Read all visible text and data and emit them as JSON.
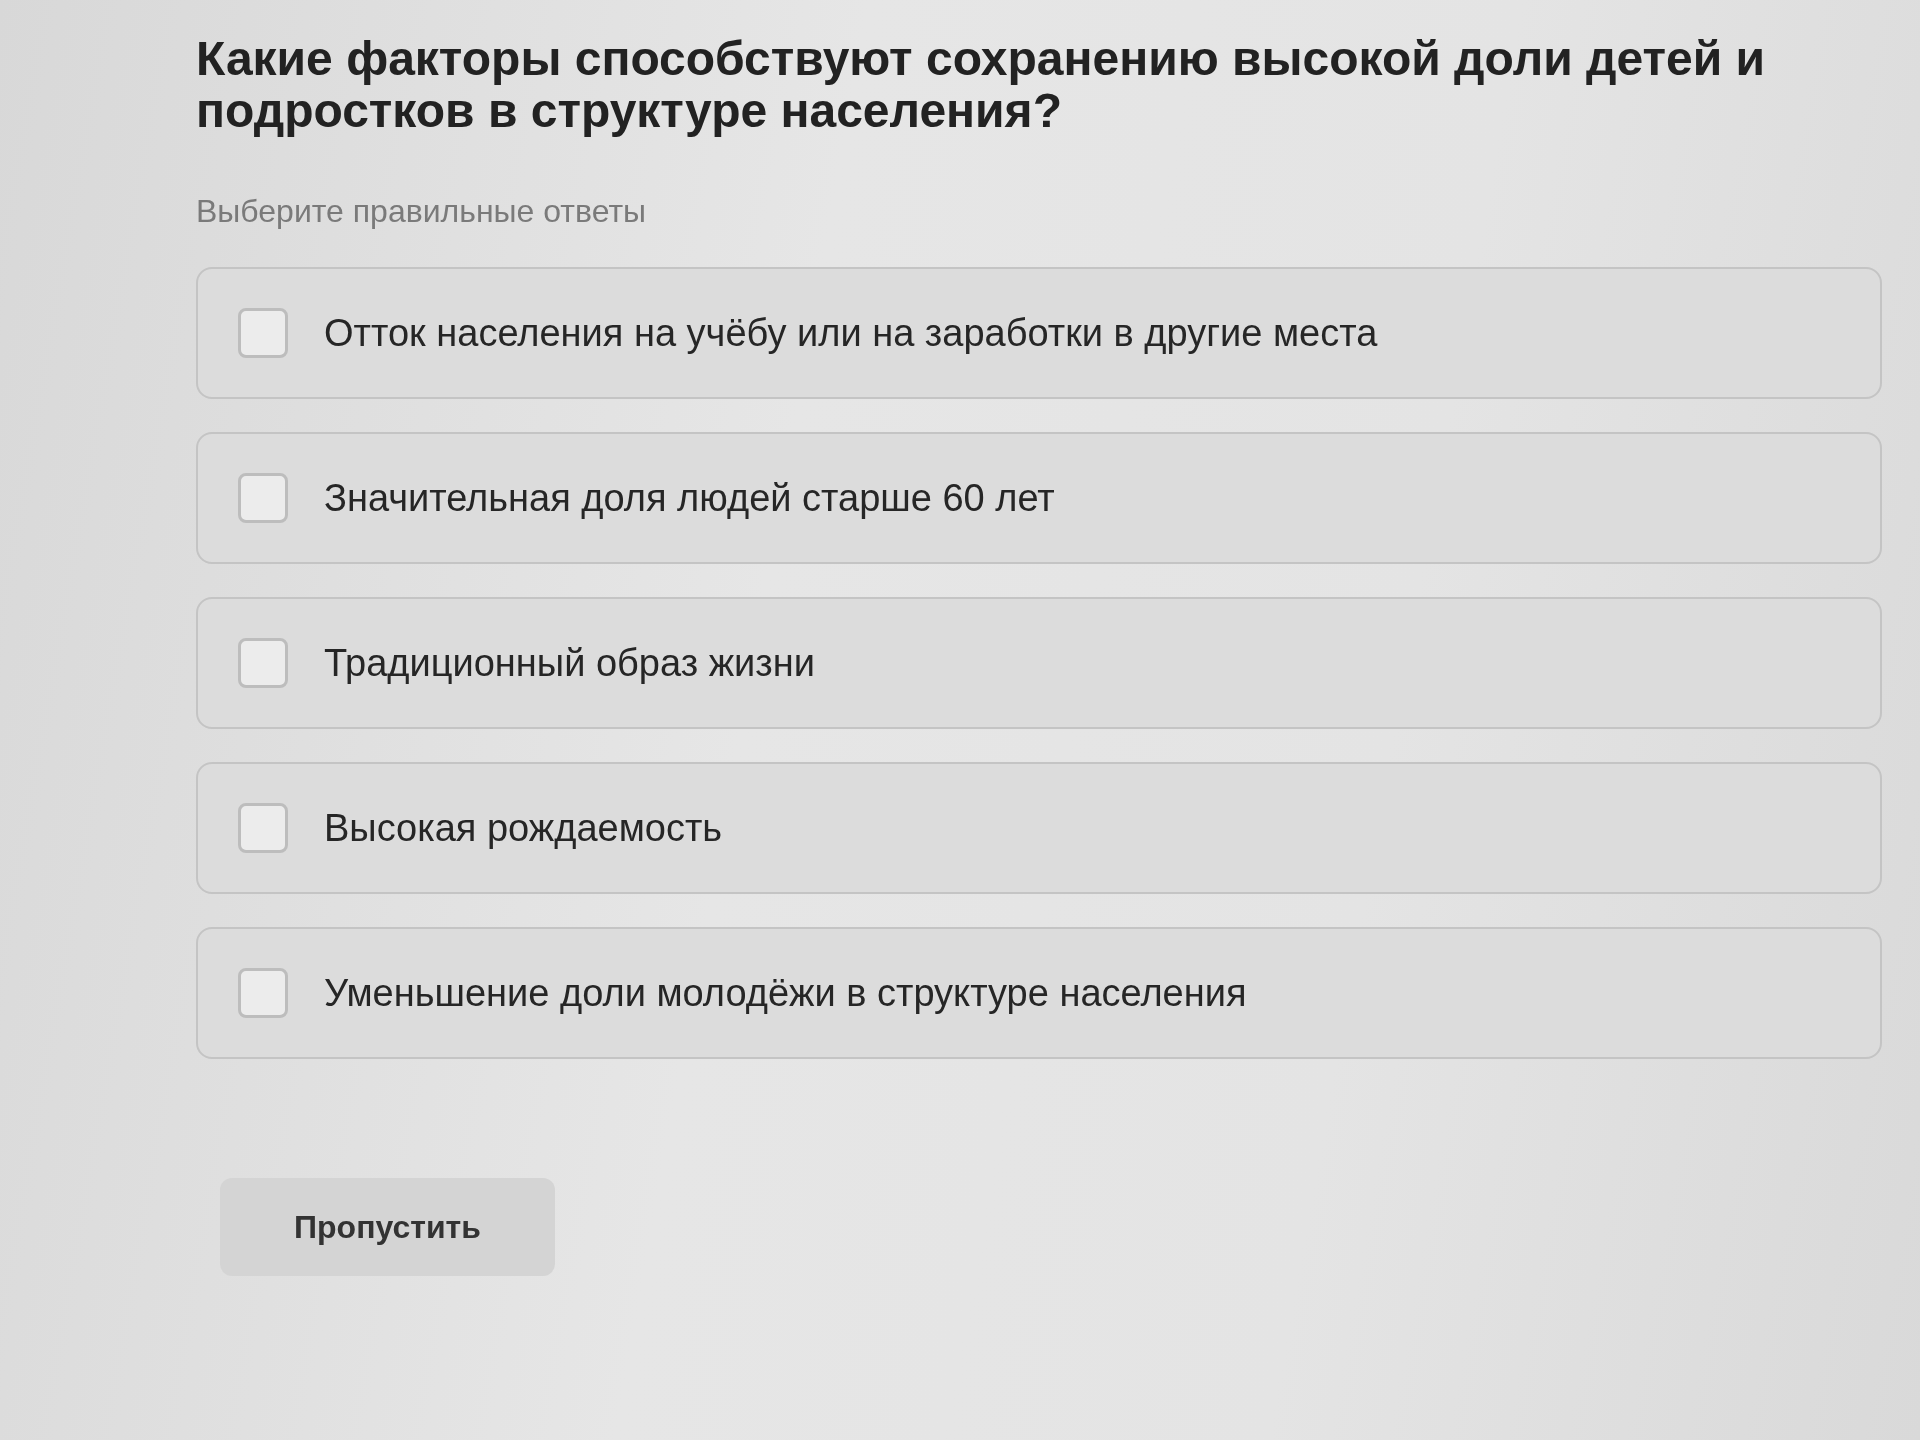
{
  "question": {
    "title": "Какие факторы способствуют сохранению высокой доли детей и подростков в структуре населения?",
    "instruction": "Выберите правильные ответы"
  },
  "options": [
    {
      "label": "Отток населения на учёбу или на заработки в другие места",
      "checked": false
    },
    {
      "label": "Значительная доля людей старше 60 лет",
      "checked": false
    },
    {
      "label": "Традиционный образ жизни",
      "checked": false
    },
    {
      "label": "Высокая рождаемость",
      "checked": false
    },
    {
      "label": "Уменьшение доли молодёжи в структуре населения",
      "checked": false
    }
  ],
  "skip_button": {
    "label": "Пропустить"
  }
}
